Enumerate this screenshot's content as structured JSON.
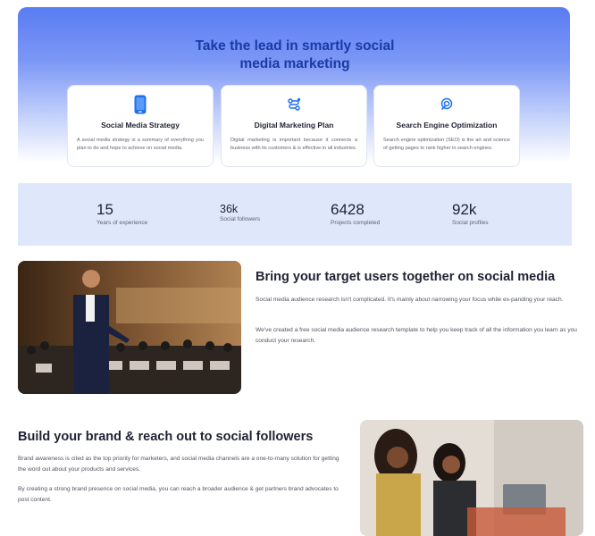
{
  "hero": {
    "title": "Take the lead in smartly social media marketing",
    "cards": [
      {
        "icon": "smartphone-icon",
        "title": "Social Media Strategy",
        "desc": "A social media strategy is a summary of everything you plan to do and hope to achieve on social media."
      },
      {
        "icon": "route-icon",
        "title": "Digital Marketing Plan",
        "desc": "Digital marketing is important because it connects a business with its customers & is effective in all industries."
      },
      {
        "icon": "seo-icon",
        "title": "Search Engine Optimization",
        "desc": "Search engine optimization (SEO) is the art and science of getting pages to rank higher in search engines."
      }
    ]
  },
  "stats": [
    {
      "value": "15",
      "label": "Years of experience"
    },
    {
      "value": "36k",
      "label": "Social followers"
    },
    {
      "value": "6428",
      "label": "Projects completed"
    },
    {
      "value": "92k",
      "label": "Social profiles"
    }
  ],
  "section1": {
    "heading": "Bring your target users together on social media",
    "p1": "Social media audience research isn't complicated. It's mainly about narrowing your focus while ex-panding your reach.",
    "p2": "We've created a free social media audience research template to help you keep track of all the information you learn as you conduct your research."
  },
  "section2": {
    "heading": "Build your brand & reach out to social followers",
    "p1": "Brand awareness is cited as the top priority for marketers, and social media channels are a one-to-many solution for getting the word out about your products and services.",
    "p2": "By creating a strong brand presence on social media, you can reach a broader audience & get partners brand advocates to post content."
  },
  "colors": {
    "accent": "#1a3aa6",
    "hero_top": "#5a7cf3",
    "stats_bg": "#dfe7fb"
  }
}
